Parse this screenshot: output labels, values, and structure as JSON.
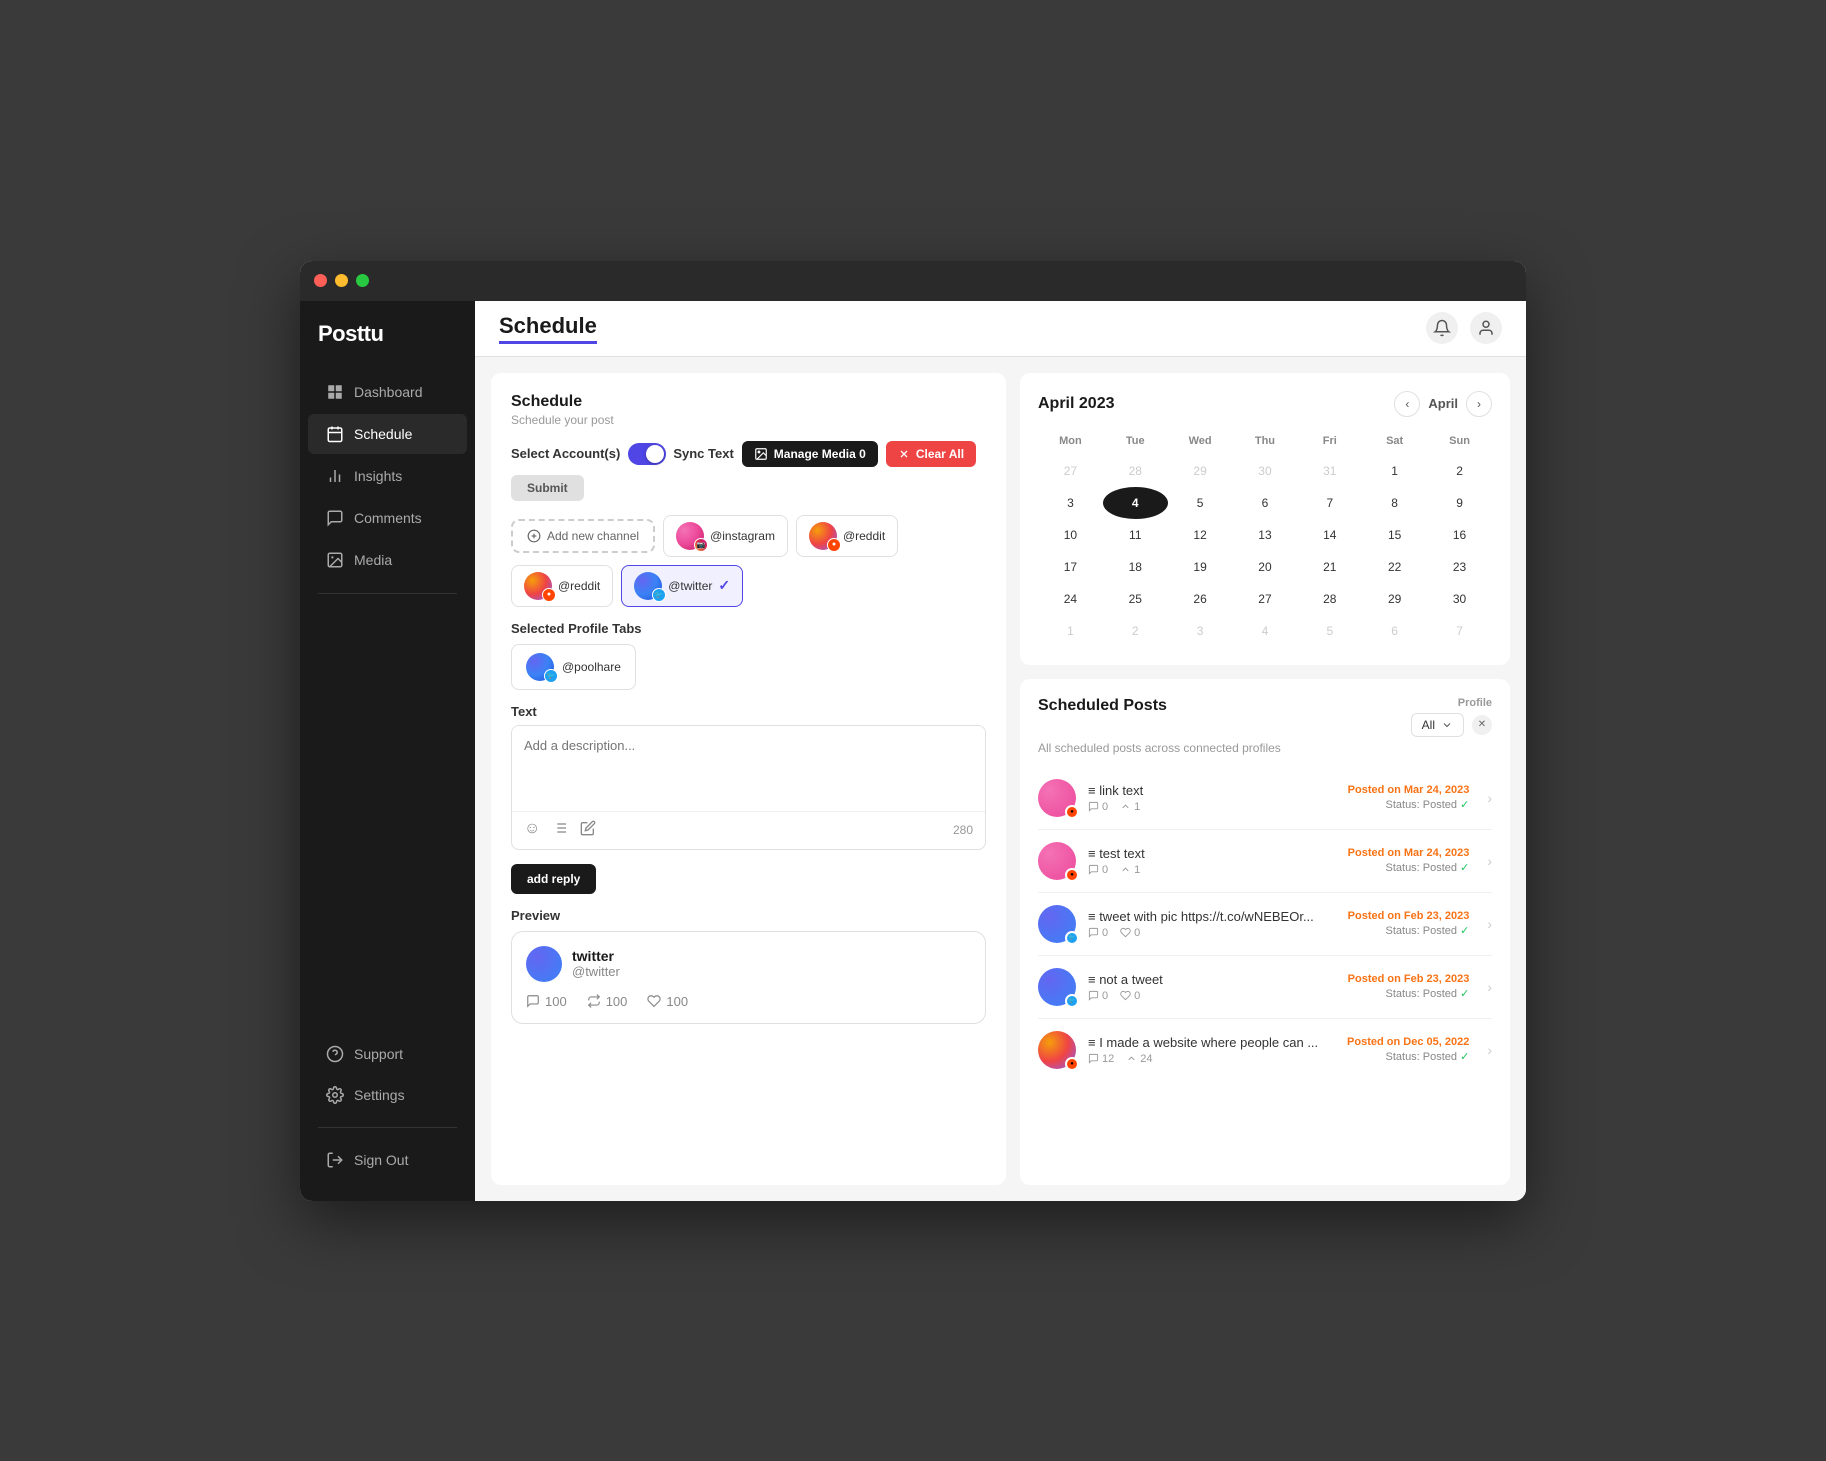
{
  "window": {
    "title": "Posttu"
  },
  "sidebar": {
    "logo": "Posttu",
    "items": [
      {
        "id": "dashboard",
        "label": "Dashboard",
        "icon": "grid"
      },
      {
        "id": "schedule",
        "label": "Schedule",
        "icon": "calendar",
        "active": true
      },
      {
        "id": "insights",
        "label": "Insights",
        "icon": "chart"
      },
      {
        "id": "comments",
        "label": "Comments",
        "icon": "message"
      },
      {
        "id": "media",
        "label": "Media",
        "icon": "image"
      }
    ],
    "bottom_items": [
      {
        "id": "support",
        "label": "Support",
        "icon": "help"
      },
      {
        "id": "settings",
        "label": "Settings",
        "icon": "gear"
      }
    ],
    "sign_out": "Sign Out"
  },
  "topbar": {
    "title": "Schedule"
  },
  "schedule": {
    "panel_title": "Schedule",
    "panel_subtitle": "Schedule your post",
    "select_account_label": "Select Account(s)",
    "sync_text_label": "Sync Text",
    "manage_media_label": "Manage Media",
    "manage_media_count": "0",
    "clear_all_label": "Clear All",
    "submit_label": "Submit",
    "add_channel_label": "Add new channel",
    "accounts": [
      {
        "handle": "@instagram",
        "type": "instagram"
      },
      {
        "handle": "@reddit",
        "type": "reddit"
      },
      {
        "handle": "@reddit",
        "type": "reddit"
      },
      {
        "handle": "@twitter",
        "type": "twitter",
        "selected": true
      }
    ],
    "selected_profile_tabs_label": "Selected Profile Tabs",
    "selected_profile": {
      "handle": "@poolhare",
      "type": "twitter"
    },
    "text_label": "Text",
    "text_placeholder": "Add a description...",
    "char_count": "280",
    "add_reply_label": "add reply",
    "preview_label": "Preview",
    "preview_post": {
      "user_name": "twitter",
      "handle": "@twitter",
      "comments": "100",
      "retweets": "100",
      "likes": "100"
    }
  },
  "calendar": {
    "title": "April 2023",
    "month_label": "April",
    "days": [
      "Mon",
      "Tue",
      "Wed",
      "Thu",
      "Fri",
      "Sat",
      "Sun"
    ],
    "weeks": [
      [
        {
          "date": "27",
          "other": true
        },
        {
          "date": "28",
          "other": true
        },
        {
          "date": "29",
          "other": true
        },
        {
          "date": "30",
          "other": true
        },
        {
          "date": "31",
          "other": true
        },
        {
          "date": "1"
        },
        {
          "date": "2"
        }
      ],
      [
        {
          "date": "3"
        },
        {
          "date": "4",
          "today": true
        },
        {
          "date": "5"
        },
        {
          "date": "6"
        },
        {
          "date": "7"
        },
        {
          "date": "8"
        },
        {
          "date": "9"
        }
      ],
      [
        {
          "date": "10"
        },
        {
          "date": "11"
        },
        {
          "date": "12"
        },
        {
          "date": "13"
        },
        {
          "date": "14"
        },
        {
          "date": "15"
        },
        {
          "date": "16"
        }
      ],
      [
        {
          "date": "17"
        },
        {
          "date": "18"
        },
        {
          "date": "19"
        },
        {
          "date": "20"
        },
        {
          "date": "21"
        },
        {
          "date": "22"
        },
        {
          "date": "23"
        }
      ],
      [
        {
          "date": "24"
        },
        {
          "date": "25"
        },
        {
          "date": "26"
        },
        {
          "date": "27"
        },
        {
          "date": "28"
        },
        {
          "date": "29"
        },
        {
          "date": "30"
        }
      ],
      [
        {
          "date": "1",
          "other": true
        },
        {
          "date": "2",
          "other": true
        },
        {
          "date": "3",
          "other": true
        },
        {
          "date": "4",
          "other": true
        },
        {
          "date": "5",
          "other": true
        },
        {
          "date": "6",
          "other": true
        },
        {
          "date": "7",
          "other": true
        }
      ]
    ]
  },
  "scheduled_posts": {
    "title": "Scheduled Posts",
    "subtitle": "All scheduled posts across connected profiles",
    "profile_label": "Profile",
    "filter_value": "All",
    "posts": [
      {
        "id": 1,
        "text": "link text",
        "avatar_type": "pink",
        "badge_type": "reddit",
        "date": "Posted on Mar 24, 2023",
        "status": "Status: Posted",
        "comments": "0",
        "ups": "1"
      },
      {
        "id": 2,
        "text": "test text",
        "avatar_type": "pink",
        "badge_type": "reddit",
        "date": "Posted on Mar 24, 2023",
        "status": "Status: Posted",
        "comments": "0",
        "ups": "1"
      },
      {
        "id": 3,
        "text": "tweet with pic https://t.co/wNEBEOr...",
        "avatar_type": "blue",
        "badge_type": "twitter",
        "date": "Posted on Feb 23, 2023",
        "status": "Status: Posted",
        "comments": "0",
        "likes": "0"
      },
      {
        "id": 4,
        "text": "not a tweet",
        "avatar_type": "blue",
        "badge_type": "twitter",
        "date": "Posted on Feb 23, 2023",
        "status": "Status: Posted",
        "comments": "0",
        "likes": "0"
      },
      {
        "id": 5,
        "text": "I made a website where people can ...",
        "avatar_type": "multi",
        "badge_type": "reddit",
        "date": "Posted on Dec 05, 2022",
        "status": "Status: Posted",
        "comments": "12",
        "ups": "24"
      }
    ]
  }
}
